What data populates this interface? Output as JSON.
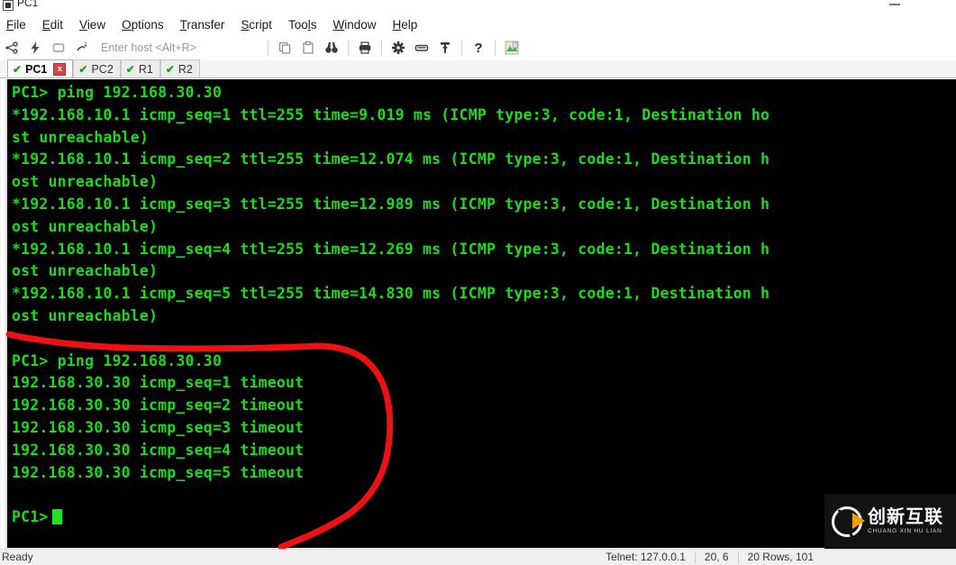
{
  "window": {
    "title": "PC1",
    "icon": "terminal-window-icon",
    "minimize_label": "—"
  },
  "menubar": {
    "items": [
      {
        "label": "File",
        "mnemonic": "F"
      },
      {
        "label": "Edit",
        "mnemonic": "E"
      },
      {
        "label": "View",
        "mnemonic": "V"
      },
      {
        "label": "Options",
        "mnemonic": "O"
      },
      {
        "label": "Transfer",
        "mnemonic": "T"
      },
      {
        "label": "Script",
        "mnemonic": "S"
      },
      {
        "label": "Tools",
        "mnemonic": "l"
      },
      {
        "label": "Window",
        "mnemonic": "W"
      },
      {
        "label": "Help",
        "mnemonic": "H"
      }
    ]
  },
  "toolbar": {
    "host_placeholder": "Enter host <Alt+R>",
    "host_value": "",
    "icons": [
      "connect-icon",
      "quick-connect-icon",
      "reconnect-icon",
      "disconnect-icon",
      "copy-icon",
      "paste-icon",
      "find-icon",
      "print-icon",
      "settings-gear-icon",
      "keyboard-icon",
      "key-icon",
      "help-icon",
      "log-session-icon"
    ]
  },
  "tabs": [
    {
      "label": "PC1",
      "status": "connected",
      "active": true,
      "closable": true,
      "close_label": "x"
    },
    {
      "label": "PC2",
      "status": "connected",
      "active": false,
      "closable": false,
      "close_label": ""
    },
    {
      "label": "R1",
      "status": "connected",
      "active": false,
      "closable": false,
      "close_label": ""
    },
    {
      "label": "R2",
      "status": "connected",
      "active": false,
      "closable": false,
      "close_label": ""
    }
  ],
  "terminal": {
    "prompt": "PC1>",
    "foreground_color": "#1bdc1b",
    "background_color": "#000000",
    "lines": [
      "PC1> ping 192.168.30.30",
      "*192.168.10.1 icmp_seq=1 ttl=255 time=9.019 ms (ICMP type:3, code:1, Destination ho",
      "st unreachable)",
      "*192.168.10.1 icmp_seq=2 ttl=255 time=12.074 ms (ICMP type:3, code:1, Destination h",
      "ost unreachable)",
      "*192.168.10.1 icmp_seq=3 ttl=255 time=12.989 ms (ICMP type:3, code:1, Destination h",
      "ost unreachable)",
      "*192.168.10.1 icmp_seq=4 ttl=255 time=12.269 ms (ICMP type:3, code:1, Destination h",
      "ost unreachable)",
      "*192.168.10.1 icmp_seq=5 ttl=255 time=14.830 ms (ICMP type:3, code:1, Destination h",
      "ost unreachable)",
      "",
      "PC1> ping 192.168.30.30",
      "192.168.30.30 icmp_seq=1 timeout",
      "192.168.30.30 icmp_seq=2 timeout",
      "192.168.30.30 icmp_seq=3 timeout",
      "192.168.30.30 icmp_seq=4 timeout",
      "192.168.30.30 icmp_seq=5 timeout",
      "",
      "PC1>"
    ],
    "cursor_line_index": 19
  },
  "annotation": {
    "color": "#ee1111",
    "shape": "hand-drawn-bracket",
    "description": "red hand-drawn curve bracketing the second ping block"
  },
  "watermark": {
    "chinese": "创新互联",
    "pinyin": "CHUANG XIN HU LIAN",
    "logo": "cx-logo"
  },
  "statusbar": {
    "ready": "Ready",
    "connection": "Telnet: 127.0.0.1",
    "cursor_position": "20,  6",
    "dimensions": "20 Rows, 101 "
  }
}
